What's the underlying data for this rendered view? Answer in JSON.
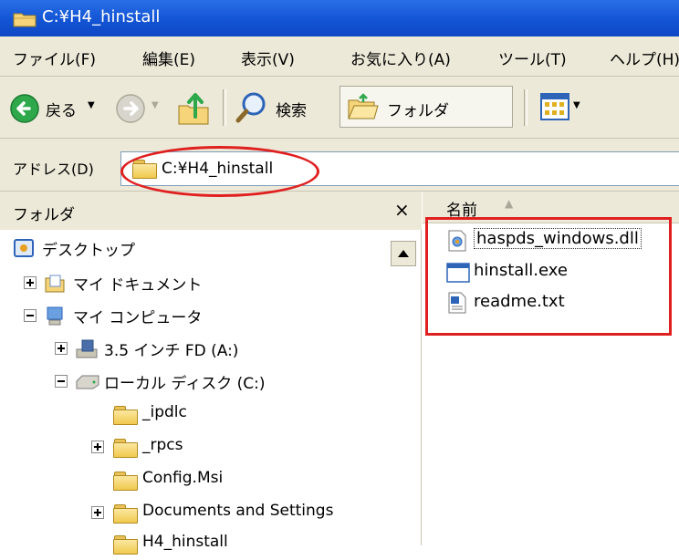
{
  "window": {
    "title": "C:¥H4_hinstall"
  },
  "menu": {
    "items": [
      "ファイル(F)",
      "編集(E)",
      "表示(V)",
      "お気に入り(A)",
      "ツール(T)",
      "ヘルプ(H)"
    ]
  },
  "toolbar": {
    "back_label": "戻る",
    "search_label": "検索",
    "folders_label": "フォルダ"
  },
  "address": {
    "label": "アドレス(D)",
    "value": "C:¥H4_hinstall"
  },
  "folders_pane": {
    "title": "フォルダ",
    "close_symbol": "×",
    "tree": [
      {
        "label": "デスクトップ"
      },
      {
        "label": "マイ ドキュメント"
      },
      {
        "label": "マイ コンピュータ"
      },
      {
        "label": "3.5 インチ FD (A:)"
      },
      {
        "label": "ローカル ディスク (C:)"
      },
      {
        "label": "_ipdlc"
      },
      {
        "label": "_rpcs"
      },
      {
        "label": "Config.Msi"
      },
      {
        "label": "Documents and Settings"
      },
      {
        "label": "H4_hinstall"
      }
    ]
  },
  "file_list": {
    "column_name": "名前",
    "sort_indicator": "▲",
    "files": [
      {
        "name": "haspds_windows.dll",
        "icon": "dll-file-icon"
      },
      {
        "name": "hinstall.exe",
        "icon": "exe-file-icon"
      },
      {
        "name": "readme.txt",
        "icon": "txt-file-icon"
      }
    ]
  },
  "annotations": {
    "highlight_color": "#e02020"
  }
}
